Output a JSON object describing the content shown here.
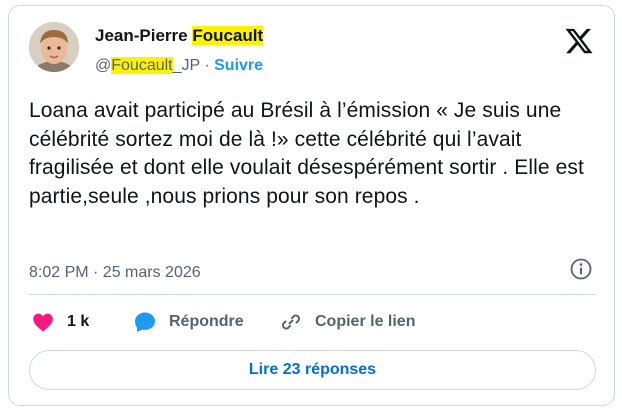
{
  "author": {
    "display_name_part1": "Jean-Pierre ",
    "display_name_highlight": "Foucault",
    "handle_prefix": "@",
    "handle_highlight": "Foucault",
    "handle_suffix": "_JP",
    "separator": " · ",
    "follow_label": "Suivre",
    "avatar": "avatar-photo"
  },
  "platform_logo": "x-logo-icon",
  "tweet": {
    "text": "Loana avait participé au Brésil à l’émission « Je suis une célébrité sortez moi de là !» cette célébrité qui l’avait fragilisée et dont elle voulait désespérément sortir . Elle est partie,seule ,nous prions pour son repos .",
    "timestamp": "8:02 PM · 25 mars 2026"
  },
  "actions": {
    "like_count": "1 k",
    "reply_label": "Répondre",
    "copy_link_label": "Copier le lien"
  },
  "read_replies_label": "Lire 23 réponses",
  "colors": {
    "accent": "#1d9bf0",
    "link_button": "#006fd6",
    "like": "#f91880",
    "highlight": "#fff200",
    "muted": "#536471",
    "border": "#cfd9de"
  }
}
